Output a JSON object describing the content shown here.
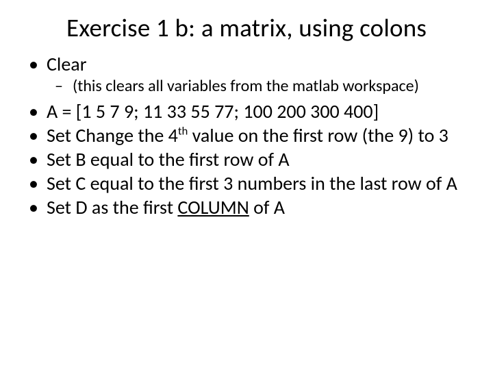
{
  "title": "Exercise 1 b: a matrix, using colons",
  "bullets": {
    "b1": "Clear",
    "b1_sub": "(this clears all variables from the matlab workspace)",
    "b2": "A = [1 5 7 9; 11 33 55 77; 100 200 300 400]",
    "b3_pre": "Set Change the 4",
    "b3_sup": "th",
    "b3_post": " value on the first row (the 9) to 3",
    "b4": "Set B equal to the first row of A",
    "b5": "Set C equal to the first 3 numbers in the last row of A",
    "b6_pre": "Set D as the first ",
    "b6_uline": "COLUMN",
    "b6_post": " of A"
  }
}
